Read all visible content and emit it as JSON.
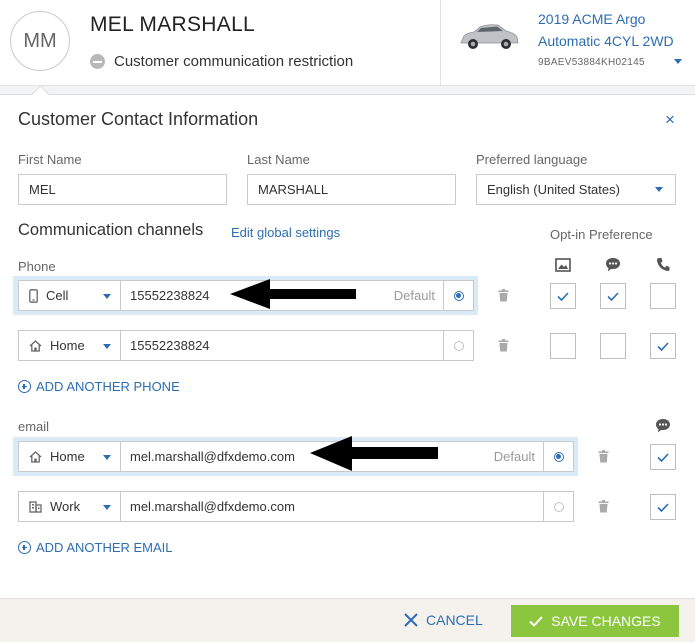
{
  "customer": {
    "initials": "MM",
    "name": "MEL MARSHALL",
    "restriction": "Customer communication restriction"
  },
  "vehicle": {
    "line1": "2019 ACME Argo",
    "line2": "Automatic 4CYL 2WD",
    "vin": "9BAEV53884KH02145"
  },
  "dialog": {
    "title": "Customer Contact Information",
    "close": "×",
    "first_name": {
      "label": "First Name",
      "value": "MEL"
    },
    "last_name": {
      "label": "Last Name",
      "value": "MARSHALL"
    },
    "language": {
      "label": "Preferred language",
      "value": "English (United States)"
    },
    "channels_title": "Communication channels",
    "edit_global": "Edit global settings",
    "optin_title": "Opt-in Preference",
    "phone_label": "Phone",
    "phones": [
      {
        "type": "Cell",
        "value": "15552238824",
        "default_label": "Default",
        "is_default": true,
        "optin": {
          "media": true,
          "text": true,
          "call": false
        }
      },
      {
        "type": "Home",
        "value": "15552238824",
        "default_label": "",
        "is_default": false,
        "optin": {
          "media": false,
          "text": false,
          "call": true
        }
      }
    ],
    "add_phone": "ADD ANOTHER PHONE",
    "email_label": "email",
    "emails": [
      {
        "type": "Home",
        "value": "mel.marshall@dfxdemo.com",
        "default_label": "Default",
        "is_default": true,
        "optin": true
      },
      {
        "type": "Work",
        "value": "mel.marshall@dfxdemo.com",
        "default_label": "",
        "is_default": false,
        "optin": true
      }
    ],
    "add_email": "ADD ANOTHER EMAIL",
    "cancel": "CANCEL",
    "save": "SAVE CHANGES"
  },
  "colors": {
    "accent": "#2d6db3",
    "save": "#8cc63f",
    "highlight": "#dbeaf7"
  },
  "icons": [
    "minus-circle-icon",
    "car-icon",
    "close-icon",
    "chevron-down-icon",
    "mobile-icon",
    "home-icon",
    "building-icon",
    "image-icon",
    "chat-icon",
    "phone-icon",
    "trash-icon",
    "check-icon",
    "plus-circle-icon",
    "arrow-icon"
  ]
}
